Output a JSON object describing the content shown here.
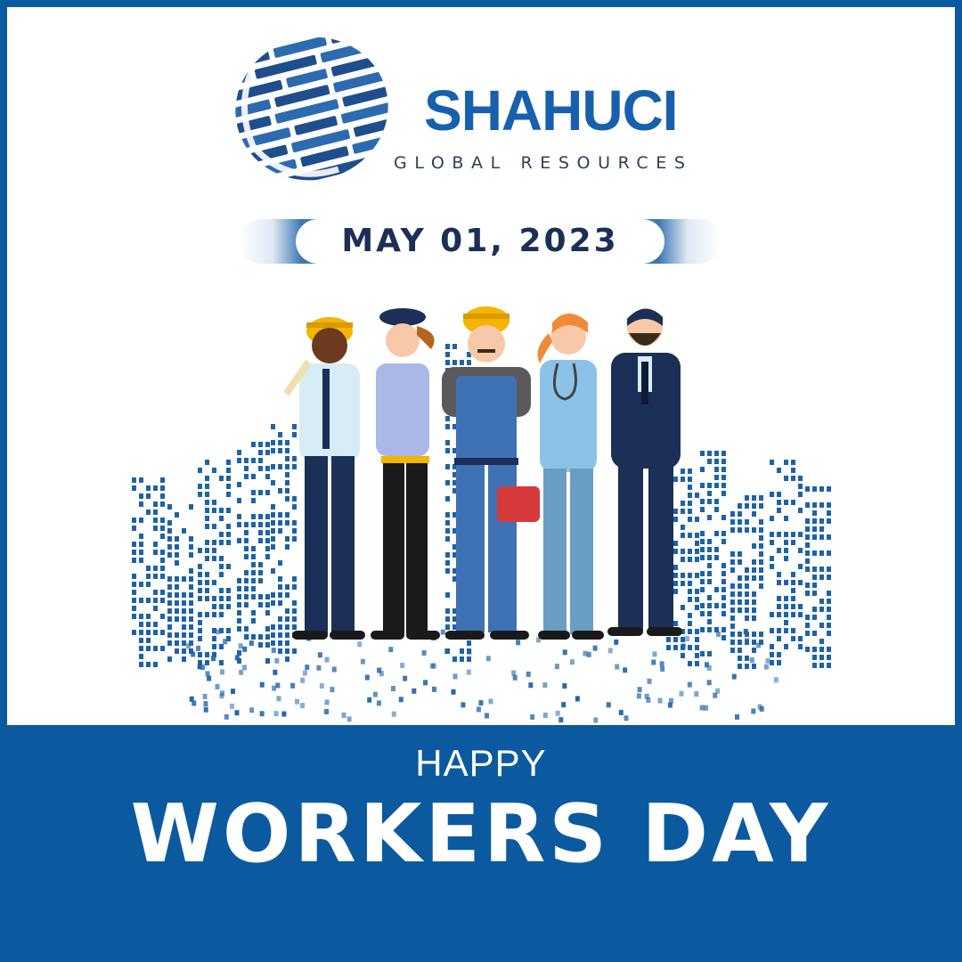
{
  "brand": {
    "name": "SHAHUCI",
    "tagline": "GLOBAL RESOURCES"
  },
  "date": "MAY 01, 2023",
  "greeting": {
    "line1": "HAPPY",
    "line2": "WORKERS DAY"
  },
  "illustration": {
    "workers": [
      "engineer",
      "police-officer",
      "mechanic",
      "doctor",
      "businessman"
    ]
  },
  "colors": {
    "brand_blue": "#0b5aa0",
    "logo_blue": "#1760ad",
    "date_text": "#1b2f57"
  }
}
